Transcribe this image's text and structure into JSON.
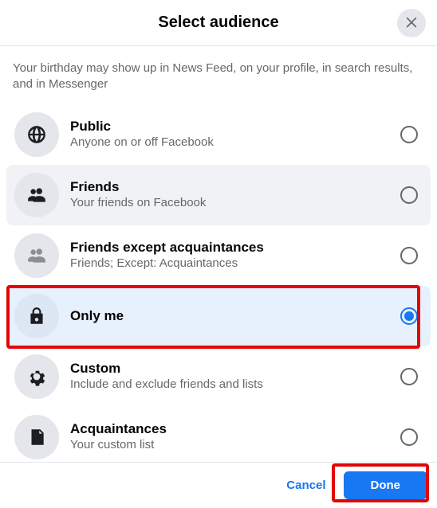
{
  "header": {
    "title": "Select audience"
  },
  "description": "Your birthday may show up in News Feed, on your profile, in search results, and in Messenger",
  "options": {
    "public": {
      "title": "Public",
      "sub": "Anyone on or off Facebook"
    },
    "friends": {
      "title": "Friends",
      "sub": "Your friends on Facebook"
    },
    "except": {
      "title": "Friends except acquaintances",
      "sub": "Friends; Except: Acquaintances"
    },
    "onlyme": {
      "title": "Only me"
    },
    "custom": {
      "title": "Custom",
      "sub": "Include and exclude friends and lists"
    },
    "acq": {
      "title": "Acquaintances",
      "sub": "Your custom list"
    }
  },
  "footer": {
    "cancel": "Cancel",
    "done": "Done"
  },
  "selected": "onlyme"
}
